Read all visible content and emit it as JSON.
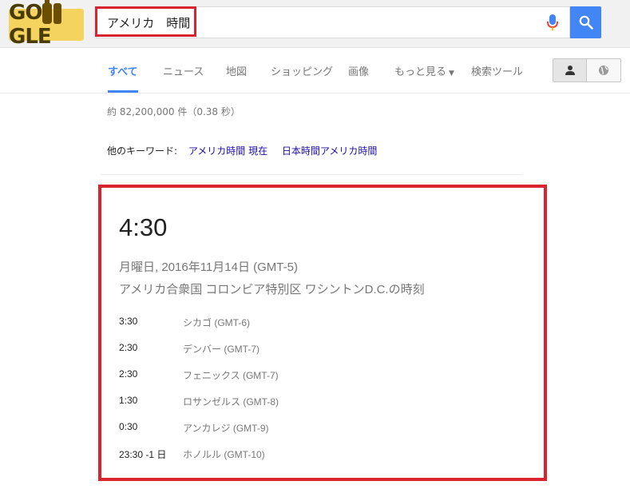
{
  "header": {
    "logo_text": "GO GLE",
    "search_value": "アメリカ　時間",
    "search_placeholder": ""
  },
  "nav": {
    "tabs": [
      {
        "label": "すべて",
        "active": true
      },
      {
        "label": "ニュース",
        "active": false
      },
      {
        "label": "地図",
        "active": false
      },
      {
        "label": "ショッピング",
        "active": false
      },
      {
        "label": "画像",
        "active": false
      },
      {
        "label": "もっと見る",
        "active": false
      },
      {
        "label": "検索ツール",
        "active": false
      }
    ]
  },
  "results": {
    "stats": "約 82,200,000 件（0.38 秒）",
    "related_label": "他のキーワード:",
    "related_links": [
      "アメリカ時間 現在",
      "日本時間アメリカ時間"
    ]
  },
  "time_card": {
    "time": "4:30",
    "date": "月曜日, 2016年11月14日 (GMT-5)",
    "location": "アメリカ合衆国 コロンビア特別区 ワシントンD.C.の時刻",
    "zones": [
      {
        "time": "3:30",
        "city": "シカゴ (GMT-6)"
      },
      {
        "time": "2:30",
        "city": "デンバー (GMT-7)"
      },
      {
        "time": "2:30",
        "city": "フェニックス (GMT-7)"
      },
      {
        "time": "1:30",
        "city": "ロサンゼルス (GMT-8)"
      },
      {
        "time": "0:30",
        "city": "アンカレジ (GMT-9)"
      },
      {
        "time": "23:30 -1 日",
        "city": "ホノルル (GMT-10)"
      }
    ]
  },
  "colors": {
    "accent_blue": "#4285f4",
    "highlight_red": "#d9232f",
    "link_blue": "#1a0dab"
  }
}
